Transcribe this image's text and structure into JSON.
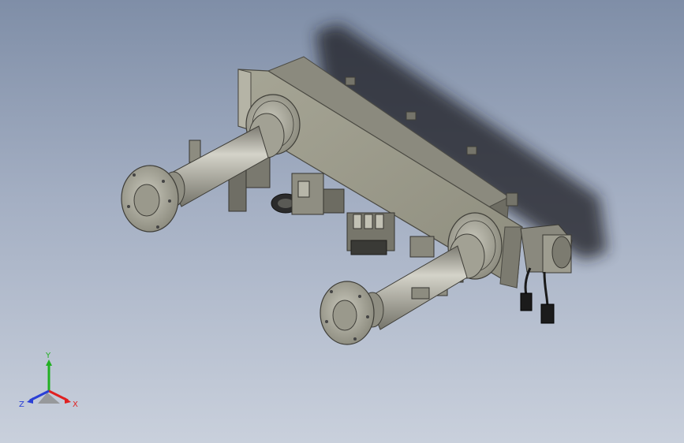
{
  "view": {
    "background_top": "#7f8ea7",
    "background_bottom": "#c9d0dc",
    "model_color": "#8f8f84"
  },
  "triad": {
    "x_label": "X",
    "y_label": "Y",
    "z_label": "Z",
    "x_color": "#e02020",
    "y_color": "#22b022",
    "z_color": "#2a3fd6"
  }
}
